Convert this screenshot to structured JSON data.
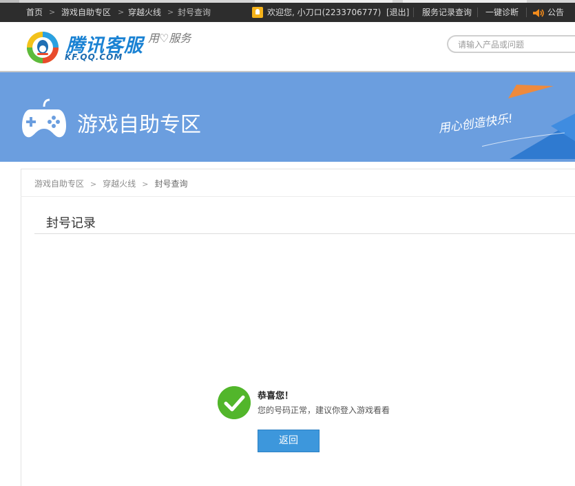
{
  "topbar": {
    "crumbs": [
      "首页",
      "游戏自助专区",
      "穿越火线",
      "封号查询"
    ],
    "crumb_separator": ">",
    "welcome": "欢迎您, 小刀ロ(2233706777)",
    "logout": "[退出]",
    "service_records": "服务记录查询",
    "diagnose": "一键诊断",
    "notice": "公告"
  },
  "header": {
    "logo_text": "腾讯客服",
    "logo_sub": "KF.QQ.COM",
    "slogan": "用♡服务",
    "search_placeholder": "请输入产品或问题"
  },
  "banner": {
    "title": "游戏自助专区",
    "slogan": "用心创造快乐!",
    "background": "#6b9edf"
  },
  "breadcrumb": {
    "items": [
      "游戏自助专区",
      "穿越火线",
      "封号查询"
    ],
    "separator": ">"
  },
  "section": {
    "title": "封号记录"
  },
  "result": {
    "title": "恭喜您！",
    "message": "您的号码正常，建议你登入游戏看看",
    "button": "返回",
    "status_color": "#52b62b",
    "button_color": "#3d97dc"
  },
  "icons": {
    "user": "user-icon",
    "speaker": "speaker-icon",
    "gamepad": "gamepad-icon",
    "check": "check-icon"
  }
}
